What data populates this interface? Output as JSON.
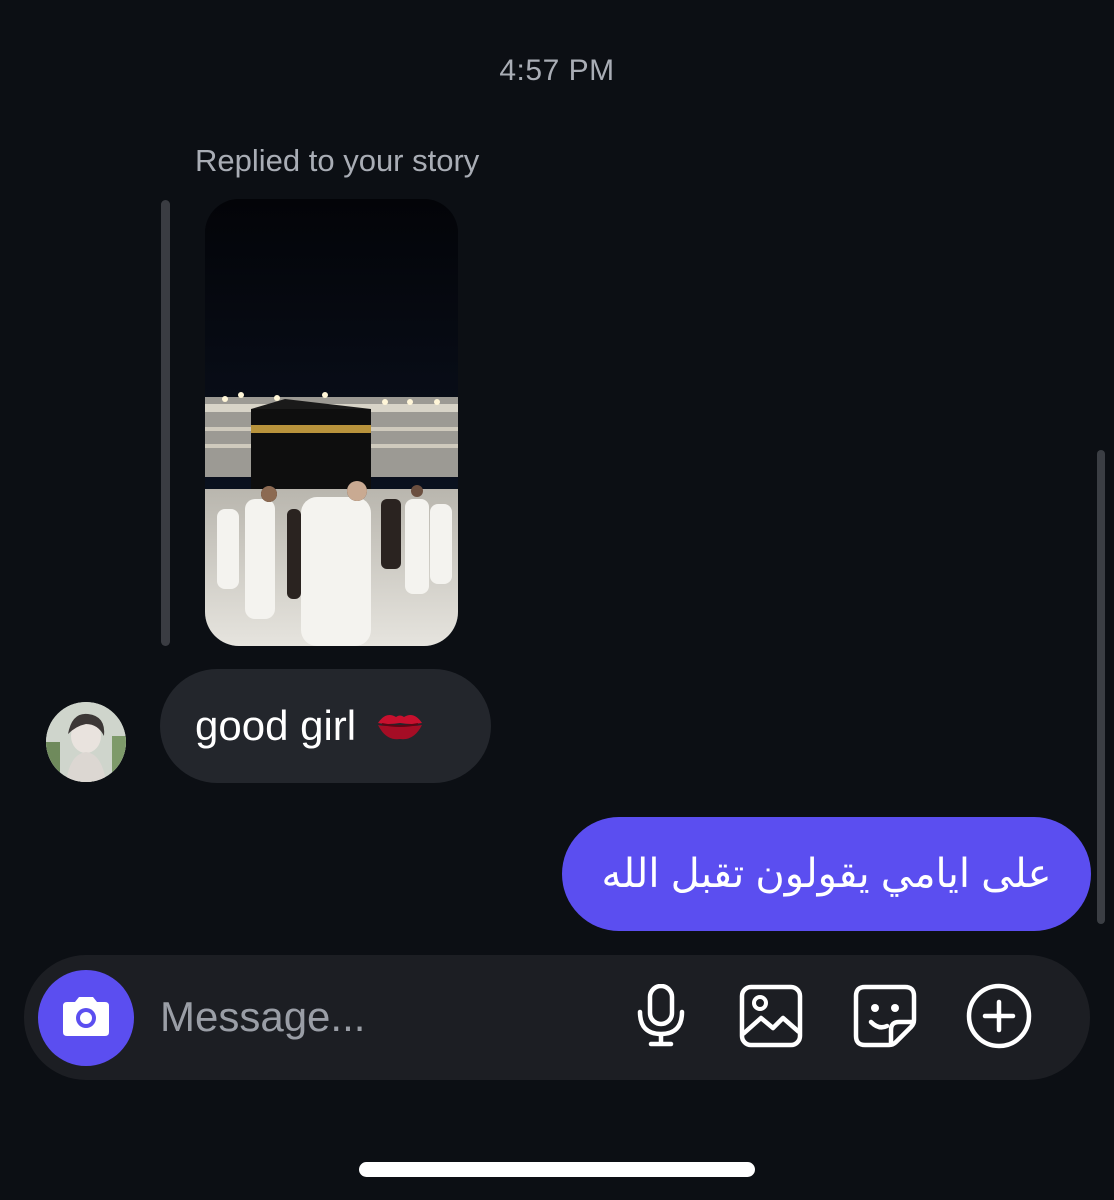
{
  "thread": {
    "timestamp": "4:57 PM",
    "story_reply_label": "Replied to your story",
    "story_thumbnail_icon": "story-image",
    "incoming_message": {
      "text": "good girl",
      "emoji": "kiss-mark-icon"
    },
    "outgoing_message": {
      "text": "على ايامي يقولون تقبل الله"
    }
  },
  "composer": {
    "placeholder": "Message...",
    "icons": [
      "camera-icon",
      "microphone-icon",
      "gallery-icon",
      "sticker-icon",
      "add-icon"
    ]
  },
  "colors": {
    "background": "#0c0f14",
    "accent": "#5b4ef0",
    "incoming_bubble": "#23262c",
    "composer_bg": "#1c1e23",
    "secondary_text": "#a9adb5"
  }
}
